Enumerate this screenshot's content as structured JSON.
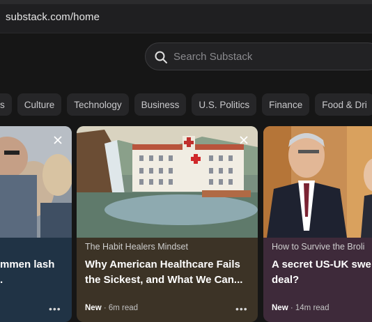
{
  "browser": {
    "url": "substack.com/home"
  },
  "search": {
    "placeholder": "Search Substack",
    "icon": "search-icon"
  },
  "categories": [
    "ers",
    "Culture",
    "Technology",
    "Business",
    "U.S. Politics",
    "Finance",
    "Food & Dri"
  ],
  "cards": [
    {
      "publication": "",
      "title_line1": "mmen lash",
      "title_line2": ".",
      "status": "",
      "read_time": "",
      "more": "•••"
    },
    {
      "publication": "The Habit Healers Mindset",
      "title_line1": "Why American Healthcare Fails",
      "title_line2": "the Sickest, and What We Can...",
      "status": "New",
      "read_time": "· 6m read",
      "more": "•••"
    },
    {
      "publication": "How to Survive the Broli",
      "title_line1": "A secret US-UK swe",
      "title_line2": "deal?",
      "status": "New",
      "read_time": "· 14m read",
      "more": ""
    }
  ],
  "colors": {
    "background": "#161616",
    "card1": "#203345",
    "card2": "#3c3326",
    "card3": "#3e2a3a"
  }
}
